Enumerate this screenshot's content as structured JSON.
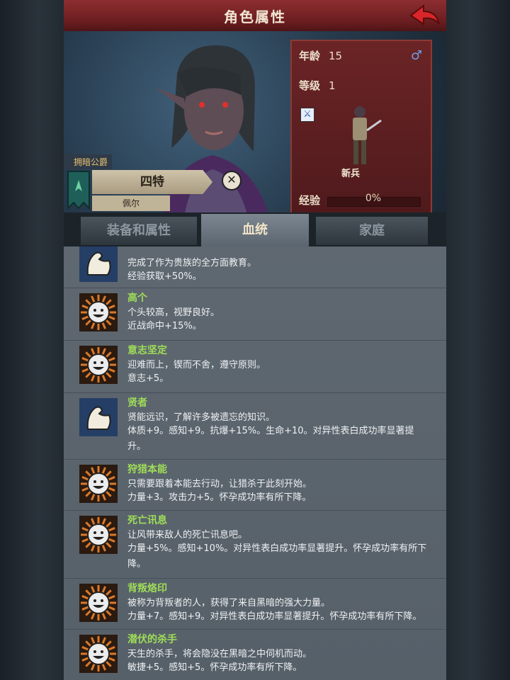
{
  "title": "角色属性",
  "character": {
    "title_rank": "拥暗公爵",
    "name": "四特",
    "surname": "佩尔",
    "close_symbol": "✕"
  },
  "stats": {
    "age_label": "年龄",
    "age": "15",
    "gender_symbol": "♂",
    "level_label": "等级",
    "level": "1",
    "unit_label": "新兵",
    "exp_label": "经验",
    "exp_text": "0%",
    "exp_progress": 0
  },
  "tabs": [
    {
      "label": "装备和属性"
    },
    {
      "label": "血统"
    },
    {
      "label": "家庭"
    }
  ],
  "traits": [
    {
      "name": "",
      "icon": "arm-icon",
      "desc": "完成了作为贵族的全方面教育。",
      "effect": "经验获取+50%。"
    },
    {
      "name": "高个",
      "icon": "smile-icon",
      "desc": "个头较高，视野良好。",
      "effect": "近战命中+15%。"
    },
    {
      "name": "意志坚定",
      "icon": "smile-icon",
      "desc": "迎难而上，锲而不舍，遵守原则。",
      "effect": "意志+5。"
    },
    {
      "name": "贤者",
      "icon": "arm-icon",
      "desc": "贤能远识，了解许多被遗忘的知识。",
      "effect": "体质+9。感知+9。抗爆+15%。生命+10。对异性表白成功率显著提升。"
    },
    {
      "name": "狩猎本能",
      "icon": "smile-icon",
      "desc": "只需要跟着本能去行动，让猎杀于此刻开始。",
      "effect": "力量+3。攻击力+5。怀孕成功率有所下降。"
    },
    {
      "name": "死亡讯息",
      "icon": "smile-icon",
      "desc": "让风带来敌人的死亡讯息吧。",
      "effect": "力量+5%。感知+10%。对异性表白成功率显著提升。怀孕成功率有所下降。"
    },
    {
      "name": "背叛烙印",
      "icon": "smile-icon",
      "desc": "被称为背叛者的人，获得了来自黑暗的强大力量。",
      "effect": "力量+7。感知+9。对异性表白成功率显著提升。怀孕成功率有所下降。"
    },
    {
      "name": "潜伏的杀手",
      "icon": "smile-icon",
      "desc": "天生的杀手，将会隐没在黑暗之中伺机而动。",
      "effect": "敏捷+5。感知+5。怀孕成功率有所下降。"
    }
  ],
  "colors": {
    "trait_name": "#9fdd58",
    "header_red": "#6a1d20",
    "icon_orange": "#d9792a",
    "icon_blue": "#243e66"
  }
}
